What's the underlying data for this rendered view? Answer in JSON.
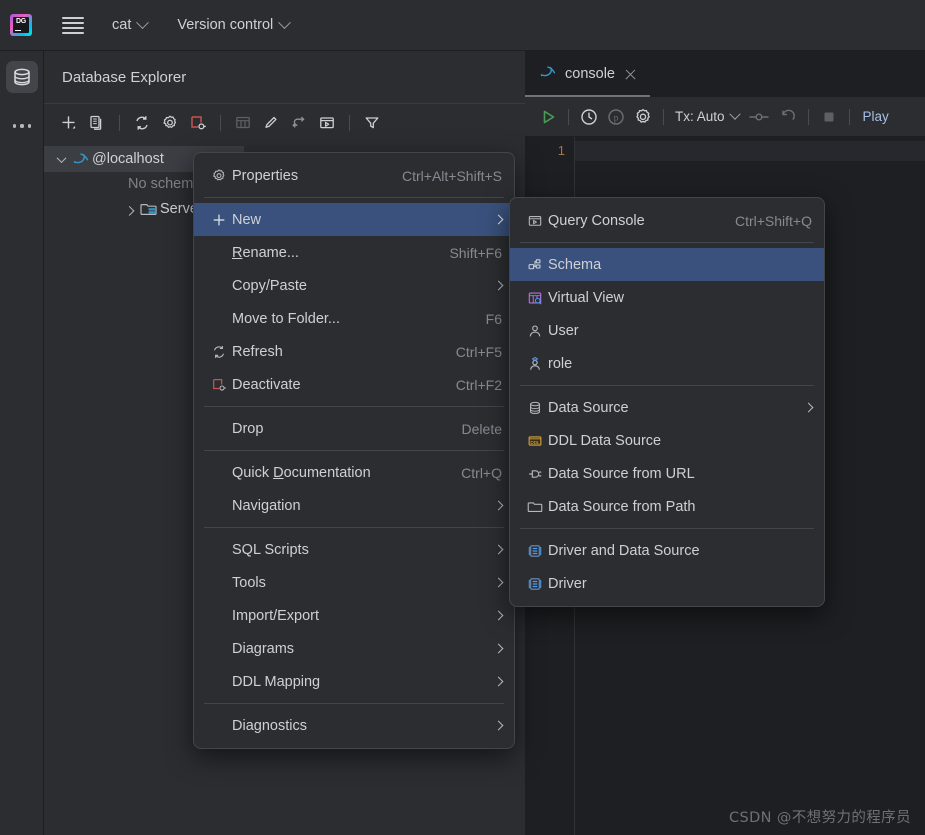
{
  "window": {
    "app_logo": "datagrip-logo",
    "logo_text": "DG",
    "menu_icon": "hamburger-icon",
    "project_name": "cat",
    "vcs_label": "Version control"
  },
  "rail": {
    "database_icon": "database-icon",
    "more_icon": "more-dots-icon"
  },
  "db_explorer": {
    "title": "Database Explorer",
    "toolbar": [
      {
        "name": "add-new-icon",
        "glyph": "+"
      },
      {
        "name": "duplicate-icon",
        "glyph": "copy"
      },
      {
        "name": "refresh-icon",
        "glyph": "refresh"
      },
      {
        "name": "settings-icon",
        "glyph": "gear"
      },
      {
        "name": "deactivate-icon",
        "glyph": "deactivate"
      },
      {
        "name": "table-editor-icon",
        "glyph": "table"
      },
      {
        "name": "modify-icon",
        "glyph": "pencil"
      },
      {
        "name": "jump-to-icon",
        "glyph": "jump"
      },
      {
        "name": "open-console-icon",
        "glyph": "console"
      },
      {
        "name": "filter-icon",
        "glyph": "filter"
      }
    ],
    "tree": [
      {
        "label": "@localhost",
        "icon": "mysql-dolphin-icon",
        "expanded": true,
        "selected": true,
        "indent": 0
      },
      {
        "label": "No schemas",
        "icon": "none",
        "expanded": false,
        "selected": false,
        "indent": 1,
        "muted": true
      },
      {
        "label": "Server",
        "icon": "server-folder-icon",
        "expanded": false,
        "selected": false,
        "indent": 1
      }
    ]
  },
  "editor": {
    "tab": {
      "label": "console",
      "icon": "mysql-dolphin-icon",
      "close": "close-icon"
    },
    "toolbar": {
      "execute": "run-icon",
      "history": "history-icon",
      "params": "parameters-icon",
      "settings": "gear-icon",
      "tx_label": "Tx: Auto",
      "commit": "commit-icon",
      "rollback": "rollback-icon",
      "stop": "stop-icon",
      "play_label": "Play"
    },
    "line_numbers": [
      "1"
    ]
  },
  "context_menu": {
    "items": [
      {
        "label": "Properties",
        "shortcut": "Ctrl+Alt+Shift+S",
        "icon": "gear-icon",
        "submenu": false,
        "highlighted": false
      },
      {
        "separator": true
      },
      {
        "label": "New",
        "shortcut": "",
        "icon": "plus-icon",
        "submenu": true,
        "highlighted": true
      },
      {
        "label": "Rename...",
        "shortcut": "Shift+F6",
        "icon": "none",
        "submenu": false,
        "highlighted": false,
        "mnemonic": "R"
      },
      {
        "label": "Copy/Paste",
        "shortcut": "",
        "icon": "none",
        "submenu": true,
        "highlighted": false
      },
      {
        "label": "Move to Folder...",
        "shortcut": "F6",
        "icon": "none",
        "submenu": false,
        "highlighted": false
      },
      {
        "label": "Refresh",
        "shortcut": "Ctrl+F5",
        "icon": "refresh-icon",
        "submenu": false,
        "highlighted": false
      },
      {
        "label": "Deactivate",
        "shortcut": "Ctrl+F2",
        "icon": "deactivate-icon",
        "submenu": false,
        "highlighted": false
      },
      {
        "separator": true
      },
      {
        "label": "Drop",
        "shortcut": "Delete",
        "icon": "none",
        "submenu": false,
        "highlighted": false
      },
      {
        "separator": true
      },
      {
        "label": "Quick Documentation",
        "shortcut": "Ctrl+Q",
        "icon": "none",
        "submenu": false,
        "highlighted": false,
        "mnemonic": "D"
      },
      {
        "label": "Navigation",
        "shortcut": "",
        "icon": "none",
        "submenu": true,
        "highlighted": false
      },
      {
        "separator": true
      },
      {
        "label": "SQL Scripts",
        "shortcut": "",
        "icon": "none",
        "submenu": true,
        "highlighted": false
      },
      {
        "label": "Tools",
        "shortcut": "",
        "icon": "none",
        "submenu": true,
        "highlighted": false
      },
      {
        "label": "Import/Export",
        "shortcut": "",
        "icon": "none",
        "submenu": true,
        "highlighted": false
      },
      {
        "label": "Diagrams",
        "shortcut": "",
        "icon": "none",
        "submenu": true,
        "highlighted": false
      },
      {
        "label": "DDL Mapping",
        "shortcut": "",
        "icon": "none",
        "submenu": true,
        "highlighted": false
      },
      {
        "separator": true
      },
      {
        "label": "Diagnostics",
        "shortcut": "",
        "icon": "none",
        "submenu": true,
        "highlighted": false
      }
    ]
  },
  "new_submenu": {
    "items": [
      {
        "label": "Query Console",
        "shortcut": "Ctrl+Shift+Q",
        "icon": "console-icon",
        "submenu": false,
        "highlighted": false
      },
      {
        "separator": true
      },
      {
        "label": "Schema",
        "shortcut": "",
        "icon": "schema-icon",
        "submenu": false,
        "highlighted": true
      },
      {
        "label": "Virtual View",
        "shortcut": "",
        "icon": "virtual-view-icon",
        "submenu": false,
        "highlighted": false
      },
      {
        "label": "User",
        "shortcut": "",
        "icon": "user-icon",
        "submenu": false,
        "highlighted": false
      },
      {
        "label": "role",
        "shortcut": "",
        "icon": "role-icon",
        "submenu": false,
        "highlighted": false
      },
      {
        "separator": true
      },
      {
        "label": "Data Source",
        "shortcut": "",
        "icon": "data-source-icon",
        "submenu": true,
        "highlighted": false
      },
      {
        "label": "DDL Data Source",
        "shortcut": "",
        "icon": "ddl-icon",
        "submenu": false,
        "highlighted": false
      },
      {
        "label": "Data Source from URL",
        "shortcut": "",
        "icon": "plug-icon",
        "submenu": false,
        "highlighted": false
      },
      {
        "label": "Data Source from Path",
        "shortcut": "",
        "icon": "folder-icon",
        "submenu": false,
        "highlighted": false
      },
      {
        "separator": true
      },
      {
        "label": "Driver and Data Source",
        "shortcut": "",
        "icon": "driver-icon",
        "submenu": false,
        "highlighted": false
      },
      {
        "label": "Driver",
        "shortcut": "",
        "icon": "driver-icon",
        "submenu": false,
        "highlighted": false
      }
    ]
  },
  "watermark": {
    "text": "CSDN @不想努力的程序员"
  },
  "colors": {
    "accent_highlight": "#39517c",
    "panel_bg": "#2b2d30",
    "editor_bg": "#1e1f22",
    "menu_bg": "#2b2d30",
    "text": "#ced0d6",
    "muted": "#868a91",
    "run_green": "#499c54",
    "deactivate_red": "#c75450",
    "dolphin_blue": "#3592c4"
  }
}
